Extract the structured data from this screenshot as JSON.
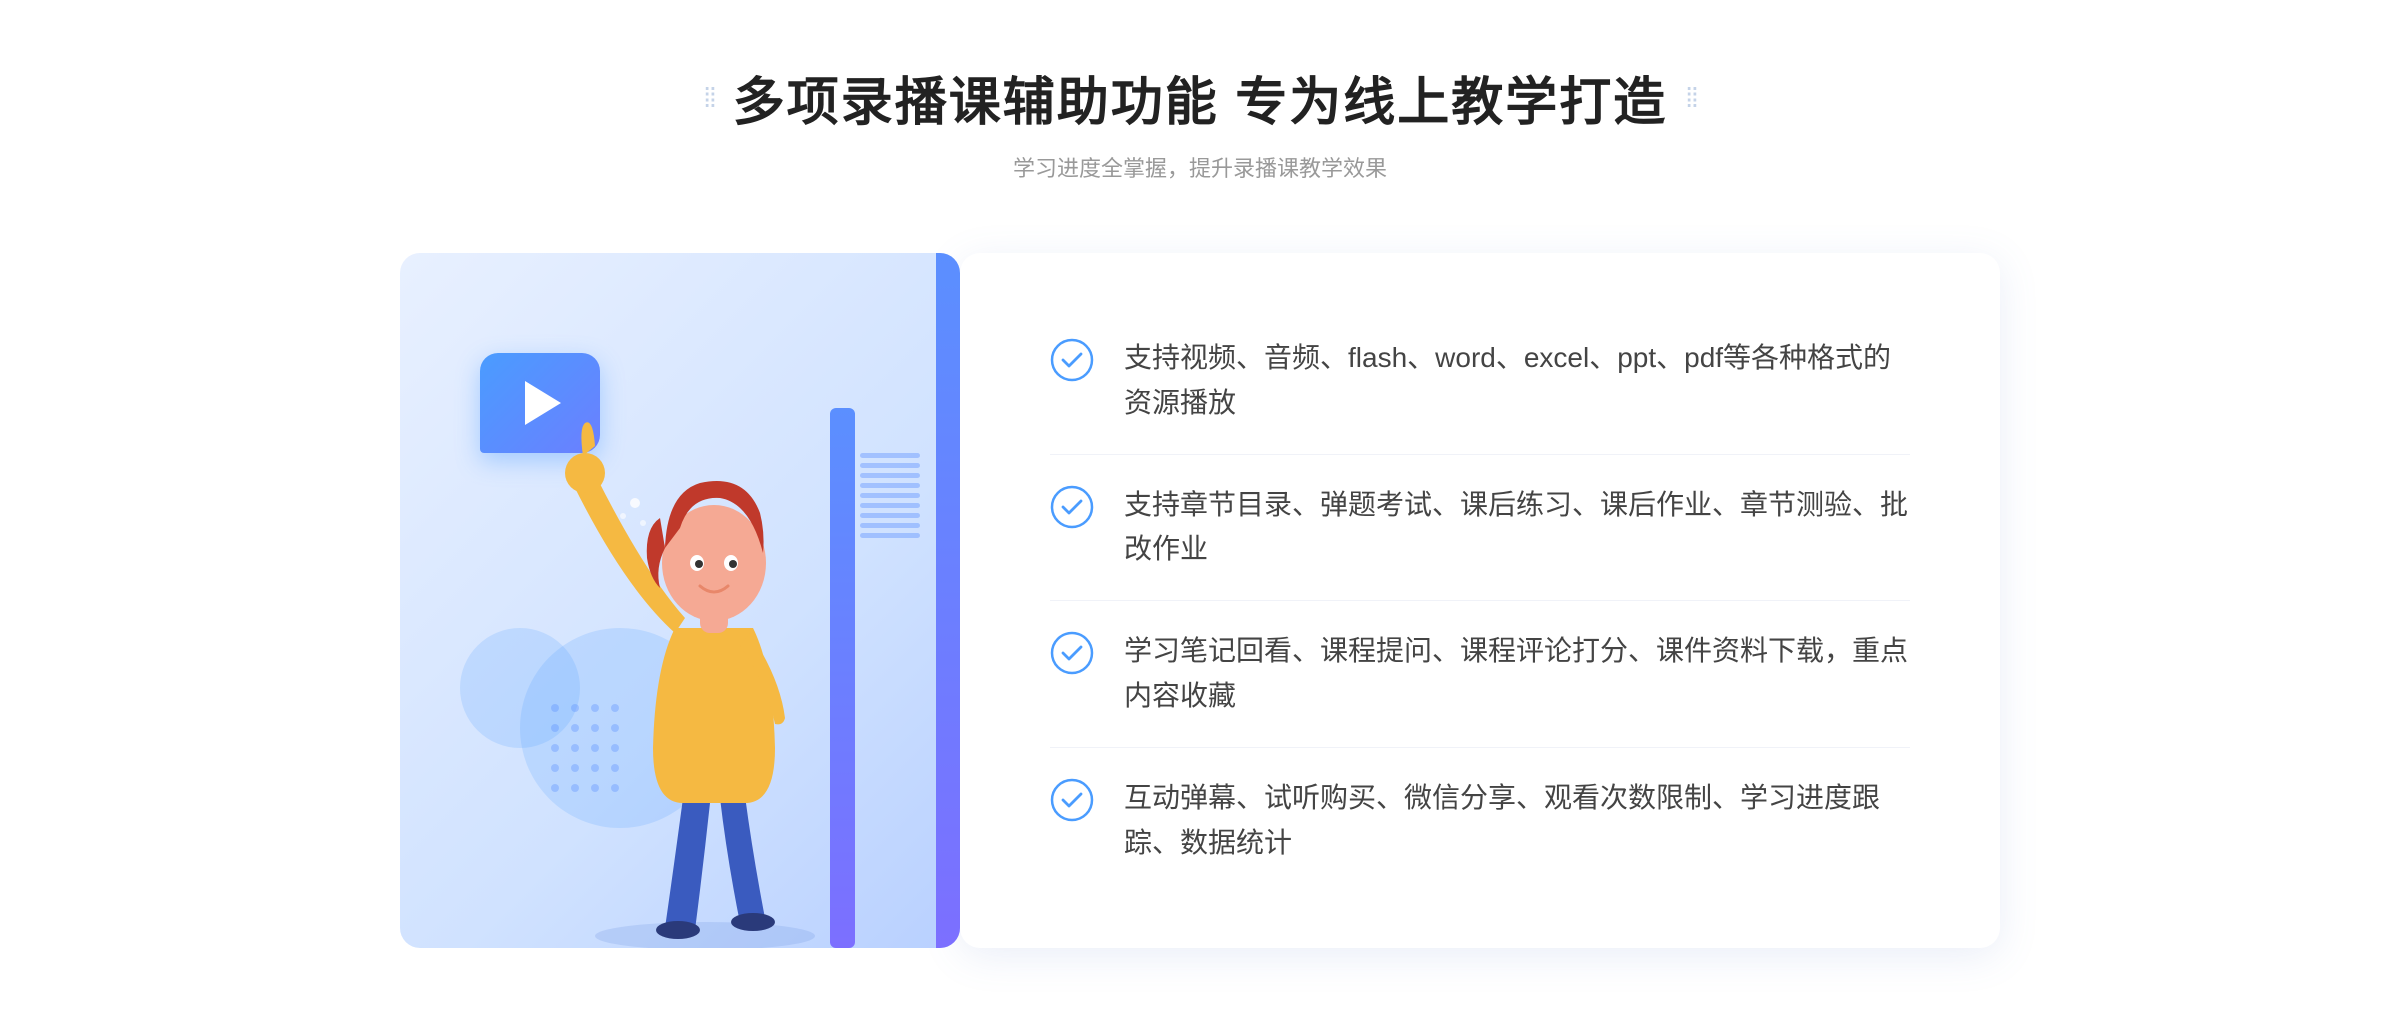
{
  "header": {
    "title": "多项录播课辅助功能 专为线上教学打造",
    "subtitle": "学习进度全掌握，提升录播课教学效果",
    "deco_left": "⁞⁞",
    "deco_right": "⁞⁞"
  },
  "features": [
    {
      "id": "feature-1",
      "text": "支持视频、音频、flash、word、excel、ppt、pdf等各种格式的资源播放"
    },
    {
      "id": "feature-2",
      "text": "支持章节目录、弹题考试、课后练习、课后作业、章节测验、批改作业"
    },
    {
      "id": "feature-3",
      "text": "学习笔记回看、课程提问、课程评论打分、课件资料下载，重点内容收藏"
    },
    {
      "id": "feature-4",
      "text": "互动弹幕、试听购买、微信分享、观看次数限制、学习进度跟踪、数据统计"
    }
  ],
  "colors": {
    "accent": "#4a9cff",
    "accent2": "#7c6fff",
    "text_dark": "#222222",
    "text_light": "#999999",
    "text_body": "#444444"
  },
  "arrows": "»",
  "check_symbol": "✓"
}
